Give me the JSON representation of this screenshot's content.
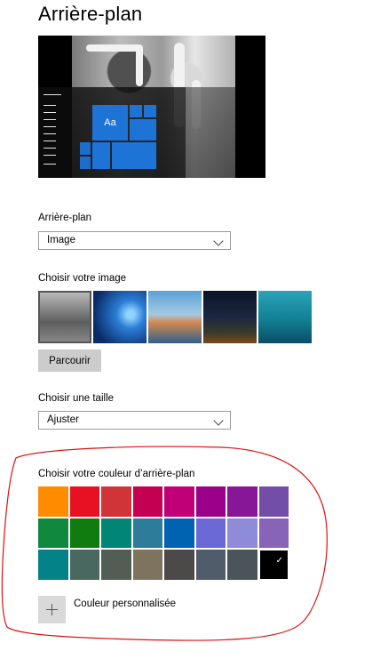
{
  "page": {
    "title": "Arrière-plan"
  },
  "preview": {
    "tile_label": "Aa"
  },
  "background": {
    "label": "Arrière-plan",
    "value": "Image"
  },
  "choose_image": {
    "label": "Choisir votre image",
    "browse_button": "Parcourir",
    "thumbnails": [
      "thumb-1",
      "thumb-2",
      "thumb-3",
      "thumb-4",
      "thumb-5"
    ]
  },
  "fit": {
    "label": "Choisir une taille",
    "value": "Ajuster"
  },
  "colors": {
    "label": "Choisir votre couleur d’arrière-plan",
    "custom_label": "Couleur personnalisée",
    "selected_index": 23,
    "palette": [
      "#ff8c00",
      "#e81123",
      "#d13438",
      "#c30052",
      "#bf0077",
      "#9a0089",
      "#881798",
      "#744da9",
      "#10893e",
      "#107c10",
      "#018574",
      "#2d7d9a",
      "#0063b1",
      "#6b69d6",
      "#8e8cd8",
      "#8764b8",
      "#038387",
      "#486860",
      "#525e54",
      "#7e735f",
      "#4c4a48",
      "#515c6b",
      "#4a5459",
      "#000000"
    ]
  },
  "annotation": {
    "color": "#e01010"
  }
}
